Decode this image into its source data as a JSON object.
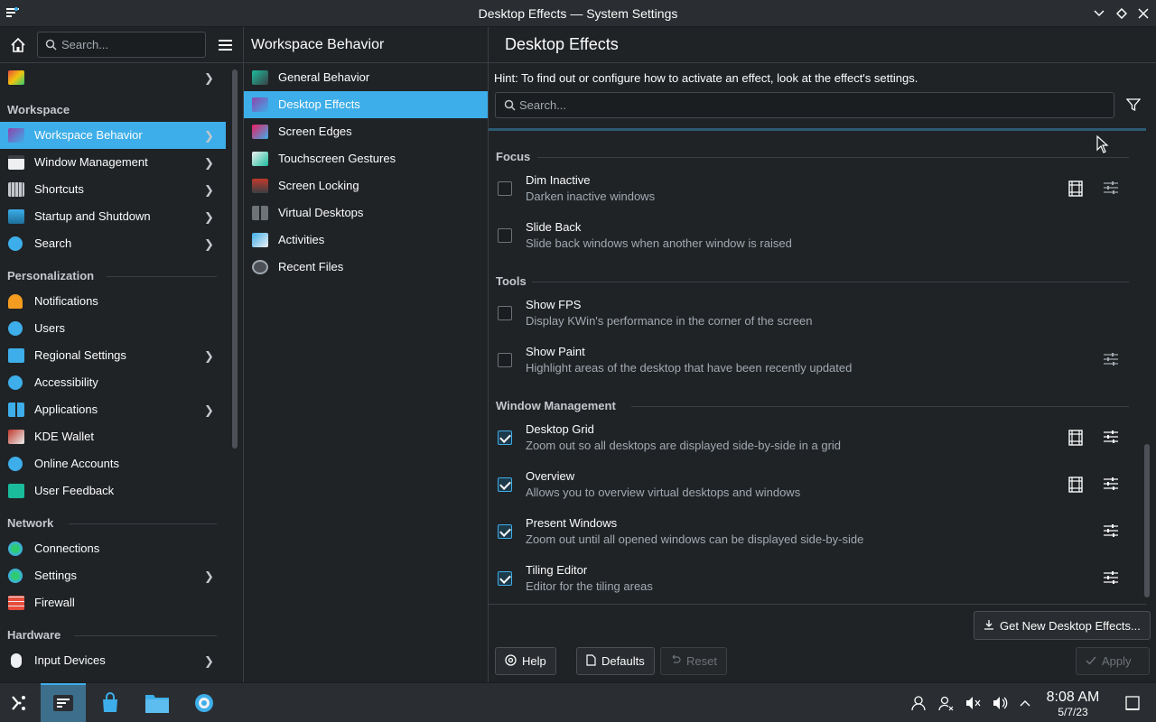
{
  "window": {
    "title": "Desktop Effects — System Settings"
  },
  "sidebar": {
    "search_placeholder": "Search...",
    "sections": {
      "workspace": "Workspace",
      "personalization": "Personalization",
      "network": "Network",
      "hardware": "Hardware"
    },
    "items": [
      {
        "label": "Workspace Behavior",
        "icon": "workspace-behavior-icon"
      },
      {
        "label": "Window Management",
        "icon": "window-management-icon"
      },
      {
        "label": "Shortcuts",
        "icon": "keyboard-icon"
      },
      {
        "label": "Startup and Shutdown",
        "icon": "startup-icon"
      },
      {
        "label": "Search",
        "icon": "search-icon"
      },
      {
        "label": "Notifications",
        "icon": "bell-icon"
      },
      {
        "label": "Users",
        "icon": "users-icon"
      },
      {
        "label": "Regional Settings",
        "icon": "regional-icon"
      },
      {
        "label": "Accessibility",
        "icon": "accessibility-icon"
      },
      {
        "label": "Applications",
        "icon": "applications-icon"
      },
      {
        "label": "KDE Wallet",
        "icon": "wallet-icon"
      },
      {
        "label": "Online Accounts",
        "icon": "online-accounts-icon"
      },
      {
        "label": "User Feedback",
        "icon": "feedback-icon"
      },
      {
        "label": "Connections",
        "icon": "globe-icon"
      },
      {
        "label": "Settings",
        "icon": "globe-icon"
      },
      {
        "label": "Firewall",
        "icon": "firewall-icon"
      },
      {
        "label": "Input Devices",
        "icon": "mouse-icon"
      }
    ]
  },
  "subnav": {
    "title": "Workspace Behavior",
    "items": [
      {
        "label": "General Behavior"
      },
      {
        "label": "Desktop Effects"
      },
      {
        "label": "Screen Edges"
      },
      {
        "label": "Touchscreen Gestures"
      },
      {
        "label": "Screen Locking"
      },
      {
        "label": "Virtual Desktops"
      },
      {
        "label": "Activities"
      },
      {
        "label": "Recent Files"
      }
    ]
  },
  "main": {
    "title": "Desktop Effects",
    "hint": "Hint: To find out or configure how to activate an effect, look at the effect's settings.",
    "search_placeholder": "Search...",
    "groups": {
      "focus": "Focus",
      "tools": "Tools",
      "window_management": "Window Management"
    },
    "effects": [
      {
        "name": "Dim Inactive",
        "desc": "Darken inactive windows",
        "checked": false
      },
      {
        "name": "Slide Back",
        "desc": "Slide back windows when another window is raised",
        "checked": false
      },
      {
        "name": "Show FPS",
        "desc": "Display KWin's performance in the corner of the screen",
        "checked": false
      },
      {
        "name": "Show Paint",
        "desc": "Highlight areas of the desktop that have been recently updated",
        "checked": false
      },
      {
        "name": "Desktop Grid",
        "desc": "Zoom out so all desktops are displayed side-by-side in a grid",
        "checked": true
      },
      {
        "name": "Overview",
        "desc": "Allows you to overview virtual desktops and windows",
        "checked": true
      },
      {
        "name": "Present Windows",
        "desc": "Zoom out until all opened windows can be displayed side-by-side",
        "checked": true
      },
      {
        "name": "Tiling Editor",
        "desc": "Editor for the tiling areas",
        "checked": true
      }
    ],
    "buttons": {
      "get_new": "Get New Desktop Effects...",
      "help": "Help",
      "defaults": "Defaults",
      "reset": "Reset",
      "apply": "Apply"
    }
  },
  "taskbar": {
    "time": "8:08 AM",
    "date": "5/7/23"
  },
  "colors": {
    "accent": "#3daee9",
    "background": "#202326",
    "panel": "#2a2e32"
  }
}
